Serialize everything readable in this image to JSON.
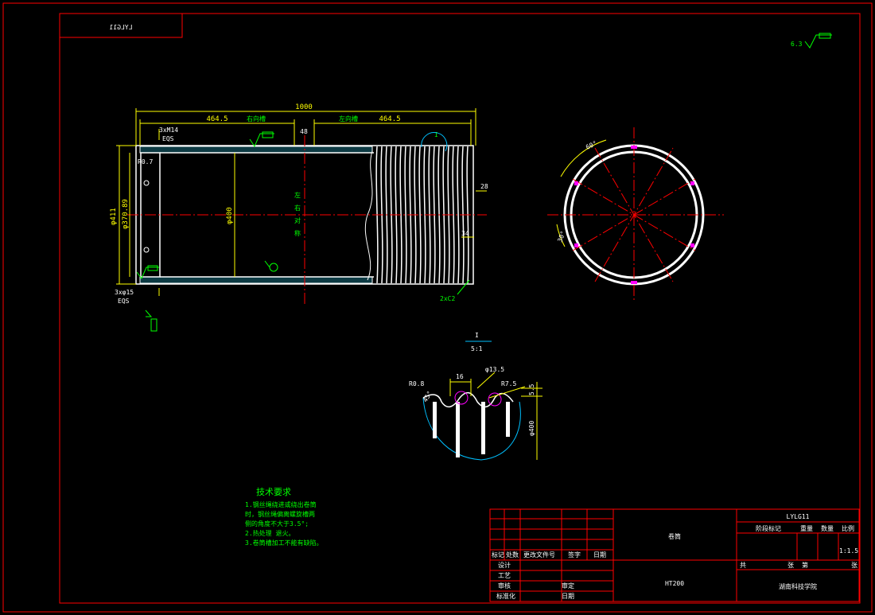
{
  "title_box_mirrored": "LYLG11",
  "dimensions": {
    "overall_length": "1000",
    "left_length": "464.5",
    "right_length": "464.5",
    "right_groove_label": "右向槽",
    "left_groove_label": "左向槽",
    "mid_gap": "48",
    "holes_top": "3xM14",
    "holes_top_eqs": "EQS",
    "r07": "R0.7",
    "dia_411": "φ411",
    "dia_37089": "φ370.89",
    "dia_400": "φ400",
    "sym_label": [
      "左",
      "右",
      "对",
      "称"
    ],
    "dim_28": "28",
    "dim_34": "34",
    "holes_bottom": "3xφ15",
    "holes_bottom_eqs": "EQS",
    "chamfer": "2xC2",
    "section_mark": "I",
    "angle_60": "60°",
    "angle_30": "30°"
  },
  "detail": {
    "label_top": "I",
    "label_scale": "5:1",
    "r08": "R0.8",
    "pitch": "16",
    "dia_135": "φ13.5",
    "r75": "R7.5",
    "depth": "5.5",
    "dia_400": "φ400",
    "angle": "45°"
  },
  "tech_requirements": {
    "heading": "技术要求",
    "lines": [
      "1.钢丝绳绕进或绕出卷筒",
      "时，钢丝绳偏离螺旋槽两",
      "侧的角度不大于3.5°;",
      "2.热处理 退火。",
      "3.卷筒槽加工不能有缺陷。"
    ]
  },
  "title_block": {
    "drawing_no": "LYLG11",
    "part_name": "卷筒",
    "material": "HT200",
    "school": "湖南科技学院",
    "stage_mark": "阶段标记",
    "weight": "重量",
    "scale": "比例",
    "count": "数量",
    "scale_value": "1:1.5",
    "total_sheets": "共",
    "sheet": "张",
    "sheet_no": "第",
    "sheet2": "张",
    "headers": [
      "标记",
      "处数",
      "更改文件号",
      "签字",
      "日期"
    ],
    "designer": "设计",
    "process": "工艺",
    "checker": "审核",
    "approve": "审定",
    "standard": "标准化",
    "date": "日期"
  },
  "surface_mark": "6.3"
}
